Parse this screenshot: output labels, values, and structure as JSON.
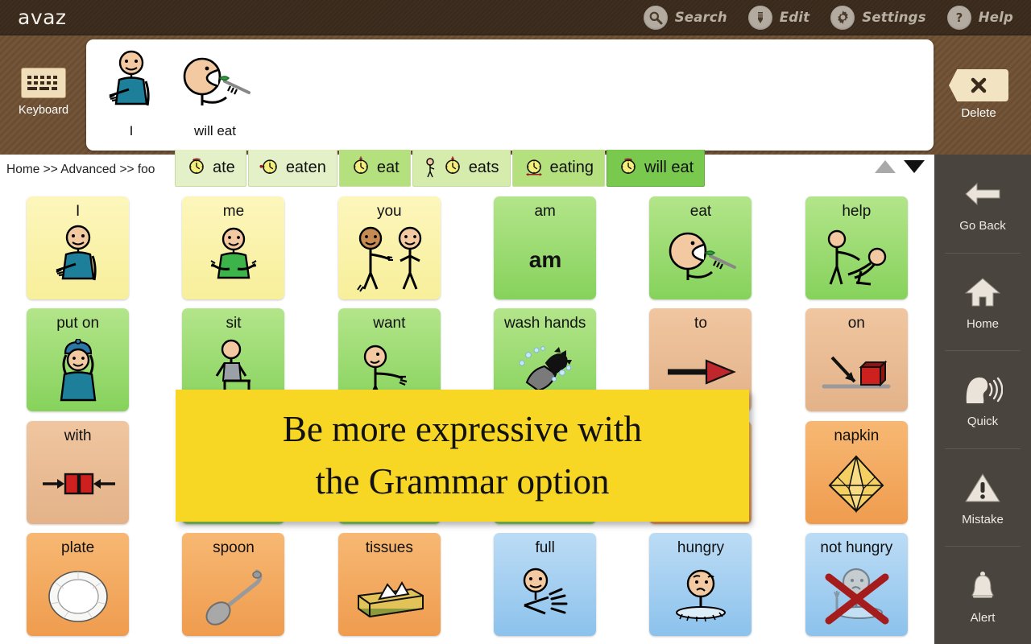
{
  "app": {
    "logo": "avaz"
  },
  "topbar": {
    "items": [
      {
        "label": "Search",
        "icon": "search-icon"
      },
      {
        "label": "Edit",
        "icon": "pencil-icon"
      },
      {
        "label": "Settings",
        "icon": "gear-icon"
      },
      {
        "label": "Help",
        "icon": "question-mark-icon"
      }
    ]
  },
  "keyboard": {
    "label": "Keyboard",
    "icon": "keyboard-icon"
  },
  "delete": {
    "label": "Delete",
    "icon": "close-x-icon"
  },
  "sentence": {
    "items": [
      {
        "label": "I",
        "icon": "person-pointing-self-icon"
      },
      {
        "label": "will eat",
        "icon": "person-eating-fork-icon"
      }
    ]
  },
  "breadcrumb": {
    "text": "Home  >>  Advanced  >>  foo"
  },
  "grammar": {
    "tenses": [
      {
        "label": "ate",
        "icon": "clock-past-icon",
        "state": "light"
      },
      {
        "label": "eaten",
        "icon": "clock-perfect-icon",
        "state": "light"
      },
      {
        "label": "eat",
        "icon": "clock-present-icon",
        "state": "mid"
      },
      {
        "label": "eats",
        "icon": "clock-present-third-icon",
        "state": "mid2"
      },
      {
        "label": "eating",
        "icon": "clock-continuous-icon",
        "state": "mid"
      },
      {
        "label": "will eat",
        "icon": "clock-future-icon",
        "state": "selected"
      }
    ],
    "scroll_up": "triangle-up-icon",
    "scroll_down": "triangle-down-icon"
  },
  "tooltip": {
    "line1": "Be more expressive with",
    "line2": "the Grammar option"
  },
  "grid": {
    "cells": [
      {
        "label": "I",
        "color": "yellow",
        "icon": "person-pointing-self-icon"
      },
      {
        "label": "me",
        "color": "yellow",
        "icon": "person-green-shirt-icon"
      },
      {
        "label": "you",
        "color": "yellow",
        "icon": "two-people-pointing-icon"
      },
      {
        "label": "am",
        "color": "green",
        "icon": "word-am-icon"
      },
      {
        "label": "eat",
        "color": "green",
        "icon": "person-eating-fork-icon"
      },
      {
        "label": "help",
        "color": "green",
        "icon": "person-helping-icon"
      },
      {
        "label": "put on",
        "color": "green",
        "icon": "person-putting-on-hat-icon"
      },
      {
        "label": "sit",
        "color": "green",
        "icon": "person-sitting-icon"
      },
      {
        "label": "want",
        "color": "green",
        "icon": "person-reaching-icon"
      },
      {
        "label": "wash hands",
        "color": "green",
        "icon": "washing-hands-icon"
      },
      {
        "label": "to",
        "color": "orange",
        "icon": "arrow-to-icon"
      },
      {
        "label": "on",
        "color": "orange",
        "icon": "arrow-on-block-icon"
      },
      {
        "label": "with",
        "color": "orange",
        "icon": "two-blocks-together-icon"
      },
      {
        "label": "",
        "color": "green",
        "icon": ""
      },
      {
        "label": "",
        "color": "green",
        "icon": ""
      },
      {
        "label": "",
        "color": "green",
        "icon": ""
      },
      {
        "label": "",
        "color": "orange2",
        "icon": ""
      },
      {
        "label": "napkin",
        "color": "orange2",
        "icon": "napkin-icon"
      },
      {
        "label": "plate",
        "color": "orange2",
        "icon": "plate-icon"
      },
      {
        "label": "spoon",
        "color": "orange2",
        "icon": "spoon-icon"
      },
      {
        "label": "tissues",
        "color": "orange2",
        "icon": "tissue-box-icon"
      },
      {
        "label": "full",
        "color": "blue",
        "icon": "person-full-icon"
      },
      {
        "label": "hungry",
        "color": "blue",
        "icon": "person-hungry-icon"
      },
      {
        "label": "not hungry",
        "color": "blue",
        "icon": "person-not-hungry-icon"
      }
    ]
  },
  "sidebar": {
    "items": [
      {
        "label": "Go Back",
        "icon": "arrow-left-icon"
      },
      {
        "label": "Home",
        "icon": "house-icon"
      },
      {
        "label": "Quick",
        "icon": "speaking-head-icon"
      },
      {
        "label": "Mistake",
        "icon": "warning-triangle-icon"
      },
      {
        "label": "Alert",
        "icon": "bell-icon"
      }
    ]
  },
  "colors": {
    "topbar": "#3a2a1c",
    "strip": "#6e4f33",
    "sidebar": "#4a443e",
    "tooltip": "#f7d724",
    "tense_selected": "#79c94e"
  }
}
